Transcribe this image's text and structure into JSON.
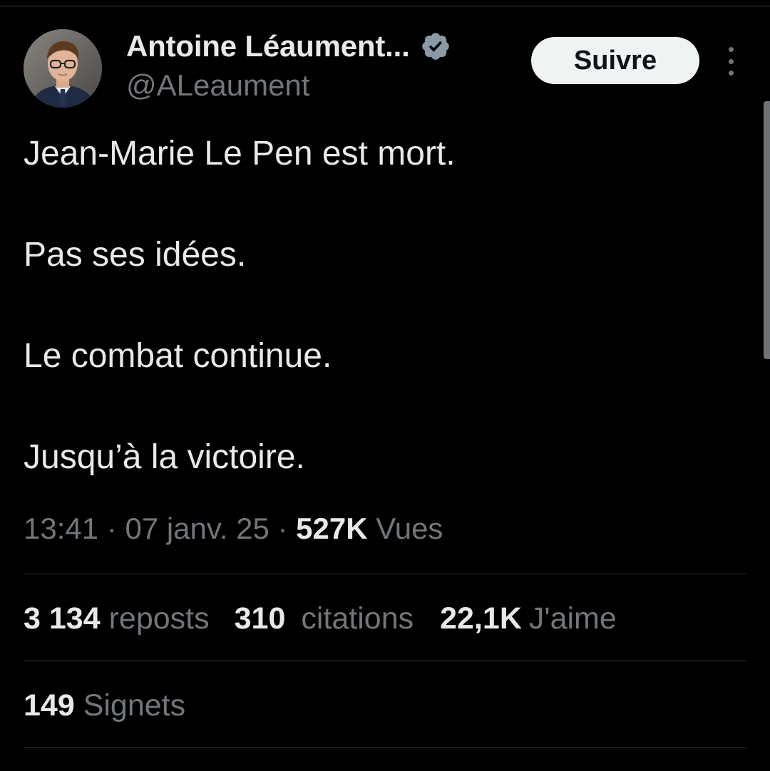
{
  "author": {
    "display_name": "Antoine Léaument...",
    "handle": "@ALeaument",
    "verified": true,
    "verified_color": "#8b98a5",
    "avatar_icon": "person-portrait"
  },
  "follow_button": {
    "label": "Suivre"
  },
  "more_icon": "more-vertical-icon",
  "tweet": {
    "lines": [
      "Jean-Marie Le Pen est mort.",
      "Pas ses idées.",
      "Le combat continue.",
      "Jusqu’à la victoire."
    ]
  },
  "meta": {
    "time": "13:41",
    "separator": "·",
    "date": "07 janv. 25",
    "views_count": "527K",
    "views_label": "Vues"
  },
  "stats": {
    "reposts_count": "3 134",
    "reposts_label": "reposts",
    "quotes_count": "310",
    "quotes_label": "citations",
    "likes_count": "22,1K",
    "likes_label": "J'aime",
    "bookmarks_count": "149",
    "bookmarks_label": "Signets"
  },
  "colors": {
    "background": "#000000",
    "text_primary": "#e7e9ea",
    "text_secondary": "#71767b",
    "divider": "#2f3336",
    "button_bg": "#eff3f4",
    "button_text": "#0f1419"
  }
}
